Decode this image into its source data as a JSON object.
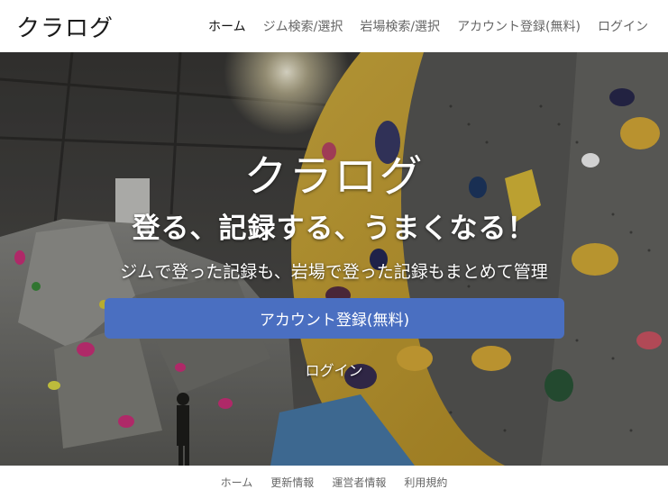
{
  "navbar": {
    "brand": "クラログ",
    "links": [
      {
        "label": "ホーム",
        "active": true
      },
      {
        "label": "ジム検索/選択"
      },
      {
        "label": "岩場検索/選択"
      },
      {
        "label": "アカウント登録(無料)"
      },
      {
        "label": "ログイン"
      }
    ]
  },
  "hero": {
    "title": "クラログ",
    "tagline": "登る、記録する、うまくなる！",
    "subtitle": "ジムで登った記録も、岩場で登った記録もまとめて管理",
    "cta_label": "アカウント登録(無料)",
    "login_label": "ログイン",
    "background": "climbing-gym-wall-photo"
  },
  "footer": {
    "links": [
      "ホーム",
      "更新情報",
      "運営者情報",
      "利用規約"
    ]
  },
  "colors": {
    "cta": "#4a6fc1",
    "navbar_bg": "#ffffff",
    "text_dark": "#111111",
    "text_muted": "#666666"
  }
}
